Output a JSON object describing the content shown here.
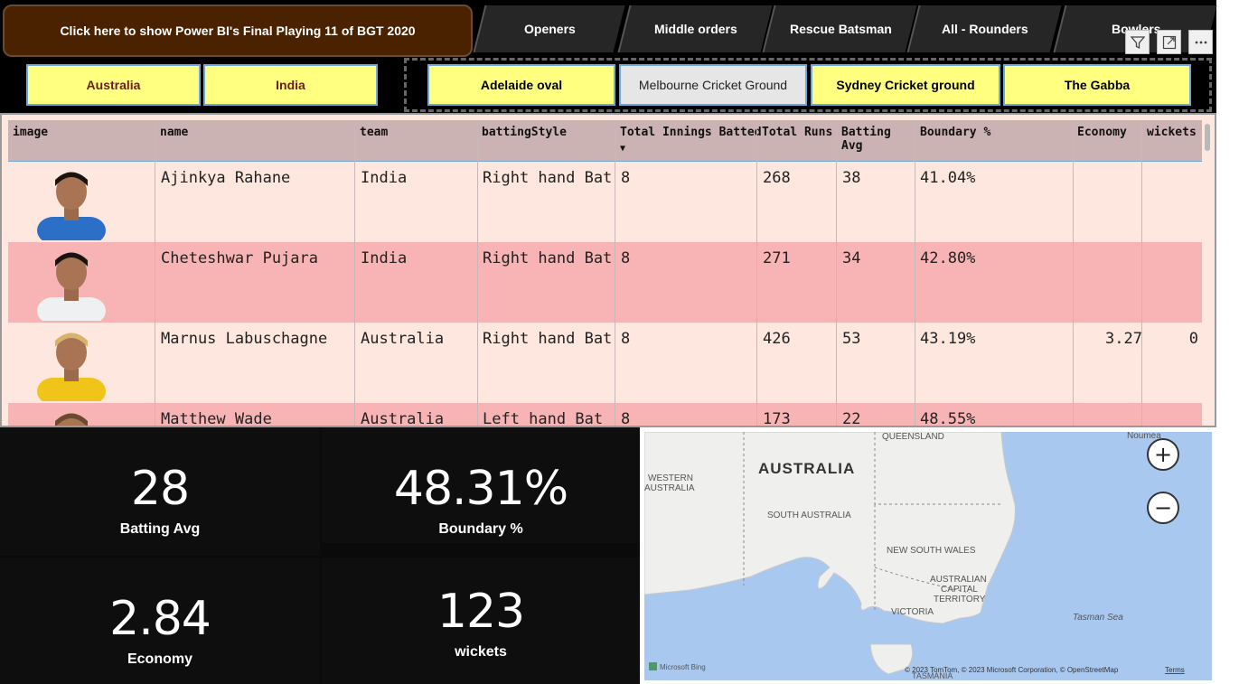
{
  "header": {
    "final11_label": "Click here to show Power BI's Final Playing 11 of BGT 2020",
    "tabs": [
      "Openers",
      "Middle orders",
      "Rescue Batsman",
      "All - Rounders",
      "Bowlers"
    ]
  },
  "toolbar_icons": [
    "filter-icon",
    "focus-mode-icon",
    "more-options-icon"
  ],
  "team_slicer": {
    "items": [
      "Australia",
      "India"
    ]
  },
  "ground_slicer": {
    "items": [
      "Adelaide oval",
      "Melbourne Cricket Ground",
      "Sydney Cricket ground",
      "The Gabba"
    ],
    "selected": "Melbourne Cricket Ground"
  },
  "table": {
    "columns": [
      "image",
      "name",
      "team",
      "battingStyle",
      "Total Innings Batted",
      "Total Runs",
      "Batting Avg",
      "Boundary %",
      "Economy",
      "wickets"
    ],
    "sort_column": "Total Innings Batted",
    "rows": [
      {
        "name": "Ajinkya Rahane",
        "team": "India",
        "battingStyle": "Right hand Bat",
        "innings": "8",
        "runs": "268",
        "avg": "38",
        "boundary": "41.04%",
        "economy": "",
        "wickets": ""
      },
      {
        "name": "Cheteshwar Pujara",
        "team": "India",
        "battingStyle": "Right hand Bat",
        "innings": "8",
        "runs": "271",
        "avg": "34",
        "boundary": "42.80%",
        "economy": "",
        "wickets": ""
      },
      {
        "name": "Marnus Labuschagne",
        "team": "Australia",
        "battingStyle": "Right hand Bat",
        "innings": "8",
        "runs": "426",
        "avg": "53",
        "boundary": "43.19%",
        "economy": "3.27",
        "wickets": "0"
      },
      {
        "name": "Matthew Wade",
        "team": "Australia",
        "battingStyle": "Left hand Bat",
        "innings": "8",
        "runs": "173",
        "avg": "22",
        "boundary": "48.55%",
        "economy": "",
        "wickets": ""
      }
    ]
  },
  "kpis": {
    "batting_avg": {
      "value": "28",
      "label": "Batting Avg"
    },
    "boundary": {
      "value": "48.31%",
      "label": "Boundary %"
    },
    "economy": {
      "value": "2.84",
      "label": "Economy"
    },
    "wickets": {
      "value": "123",
      "label": "wickets"
    }
  },
  "map": {
    "title_label": "AUSTRALIA",
    "labels": {
      "queensland": "QUEENSLAND",
      "western_australia_1": "WESTERN",
      "western_australia_2": "AUSTRALIA",
      "south_australia": "SOUTH AUSTRALIA",
      "nsw": "NEW SOUTH WALES",
      "act_1": "AUSTRALIAN",
      "act_2": "CAPITAL",
      "act_3": "TERRITORY",
      "victoria": "VICTORIA",
      "tasmania": "TASMANIA",
      "tasman_sea": "Tasman Sea",
      "noumea": "Noumea"
    },
    "attribution": "© 2023 TomTom, © 2023 Microsoft Corporation, © OpenStreetMap",
    "terms": "Terms",
    "logo": "Microsoft Bing",
    "zoom_in": "+",
    "zoom_out": "−",
    "colors": {
      "sea": "#a9c8f0",
      "land": "#efefed"
    }
  },
  "colors": {
    "slicer_bg": "#ffff80",
    "row_odd": "#fde7de",
    "row_even": "#f8b4b4",
    "header_bg": "#ccb3b3",
    "final11_bg": "#4a2200"
  }
}
